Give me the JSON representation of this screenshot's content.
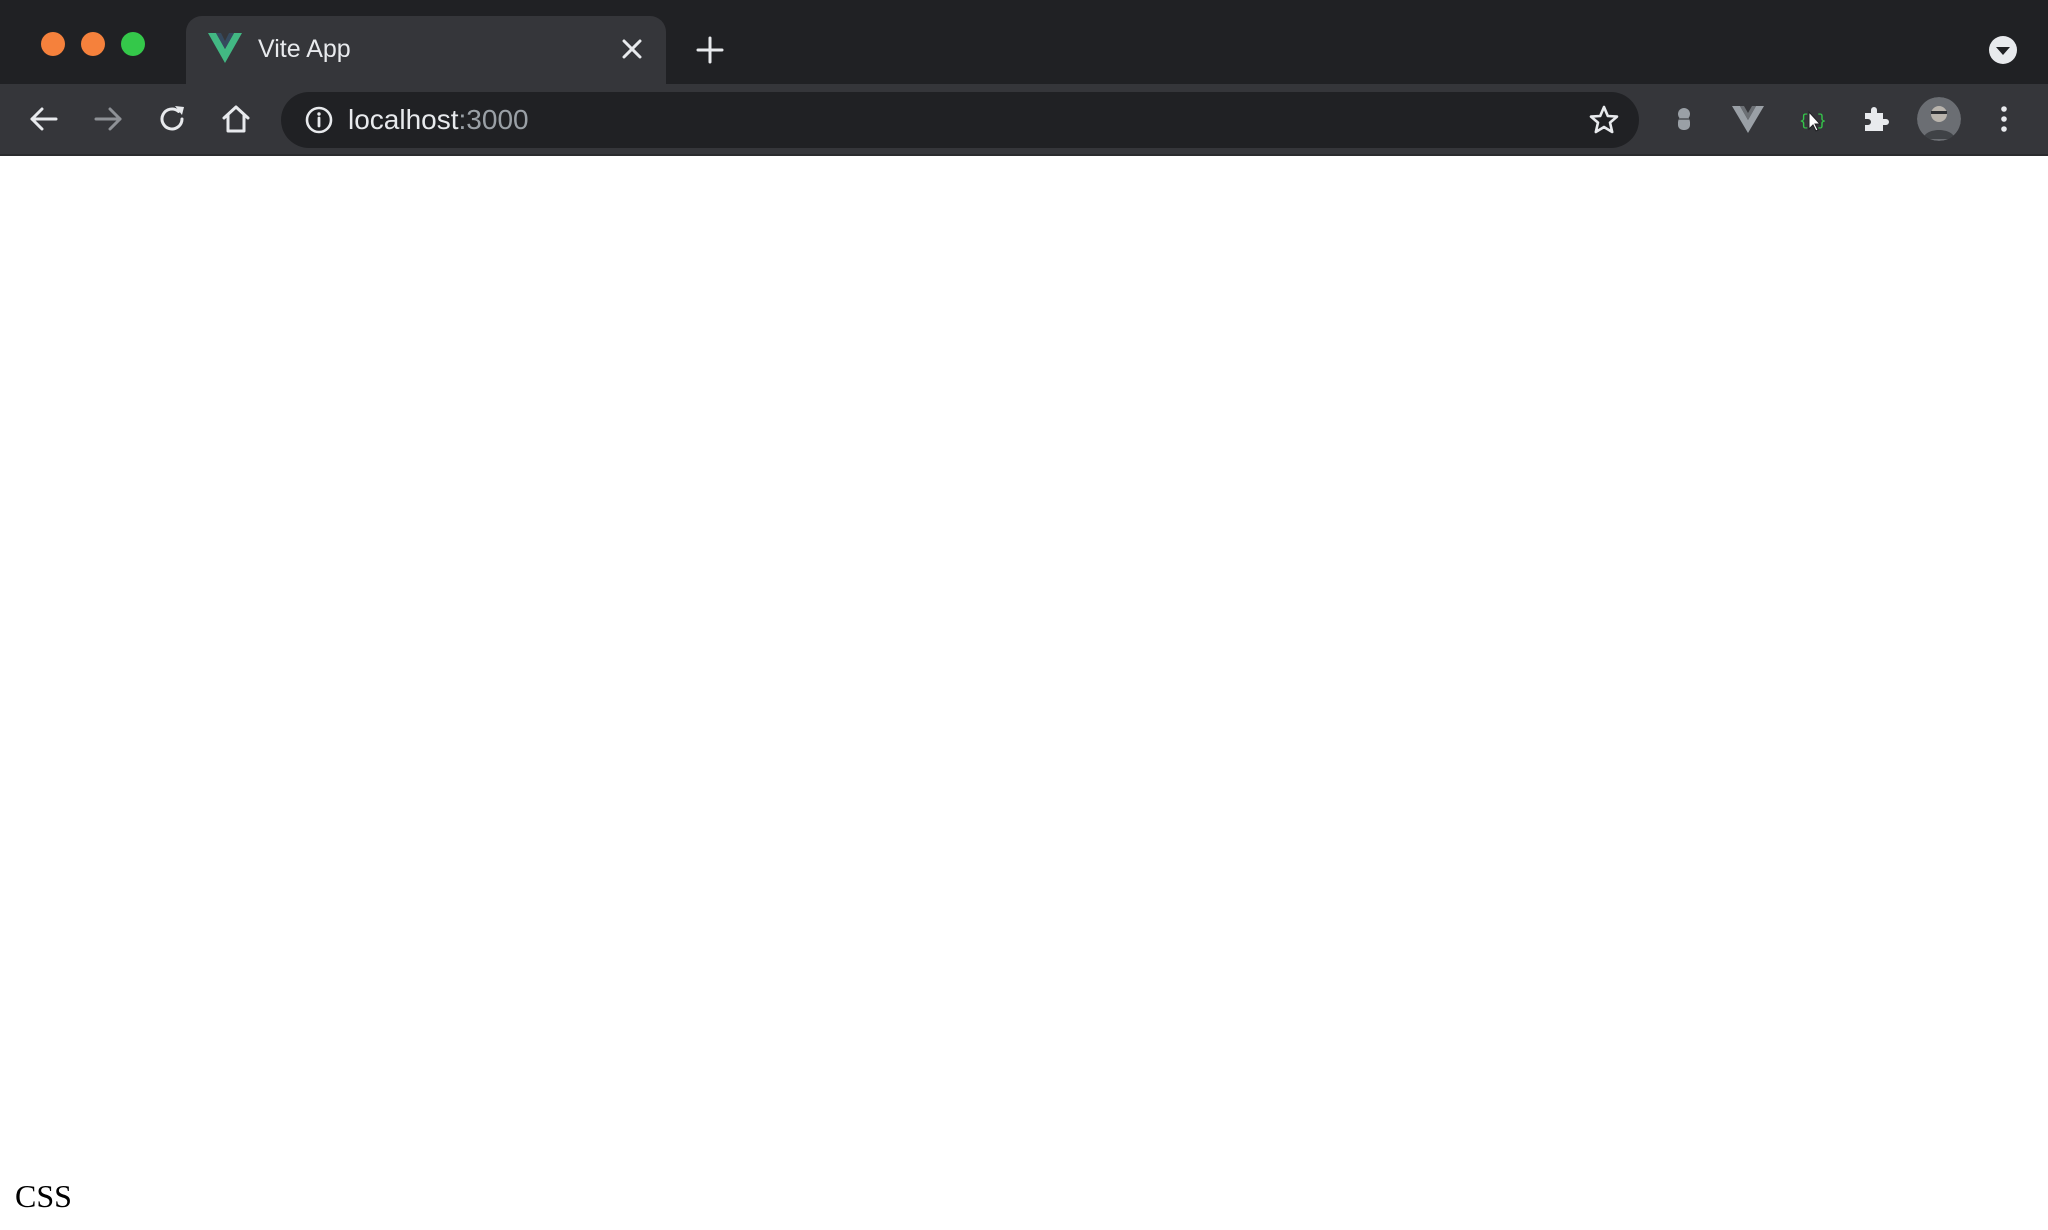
{
  "colors": {
    "tabstrip_bg": "#202124",
    "toolbar_bg": "#35363a",
    "omnibox_bg": "#202124",
    "traffic_red": "#f5813c",
    "traffic_yellow": "#f5813c",
    "traffic_green": "#34c84a",
    "vue_green": "#42b883",
    "vue_dark": "#35495e"
  },
  "tab": {
    "title": "Vite App",
    "favicon": "vue-logo-icon"
  },
  "toolbar": {
    "icons": [
      "back-arrow-icon",
      "forward-arrow-icon",
      "reload-icon",
      "home-icon",
      "star-icon",
      "extension-ghost-icon",
      "vue-devtools-icon",
      "css-selector-extension-icon",
      "puzzle-icon",
      "kebab-menu-icon"
    ]
  },
  "address_bar": {
    "host": "localhost",
    "port": ":3000"
  },
  "page": {
    "text": "CSS"
  }
}
